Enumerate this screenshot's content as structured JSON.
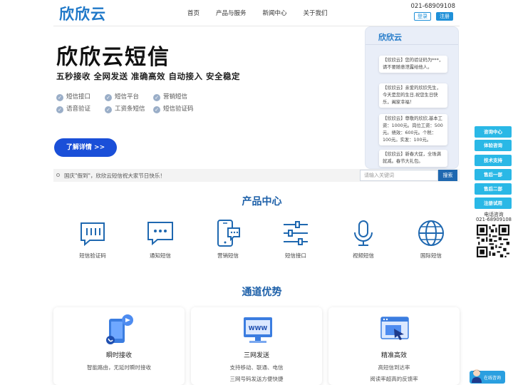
{
  "header": {
    "logo": "欣欣云",
    "nav": [
      "首页",
      "产品与服务",
      "新闻中心",
      "关于我们"
    ],
    "phone": "021-68909108",
    "login": "登录",
    "register": "注册"
  },
  "hero": {
    "title": "欣欣云短信",
    "subtitle": "五秒接收  全网发送  准确高效  自动接入  安全稳定",
    "features": [
      "短信接口",
      "短信平台",
      "营销短信",
      "语音验证",
      "工资条短信",
      "短信验证码"
    ],
    "cta": "了解详情 >>"
  },
  "phone_mockup": {
    "logo": "欣欣云",
    "messages": [
      "【欣欣云】您的验证码为***，请不要随意泄露给他人。",
      "【欣欣云】亲爱的欣欣先生，今天是您的生日,祝您生日快乐，阖家幸福！",
      "【欣欣云】尊敬的欣欣,基本工资：1000元。岗位工资：500元。绩效：600元。个税：100元。实发：100元。",
      "【欣欣云】新春大促，全场满就减。春节大礼包。"
    ]
  },
  "notice": {
    "text": "国庆\"假到\"，欣欣云短信祝大家节日快乐！",
    "search_placeholder": "请输入关键词",
    "search_button": "搜索"
  },
  "products": {
    "title": "产品中心",
    "items": [
      {
        "label": "短信验证码",
        "icon": "sms-code-icon"
      },
      {
        "label": "通知短信",
        "icon": "chat-bubble-icon"
      },
      {
        "label": "营销短信",
        "icon": "mobile-chat-icon"
      },
      {
        "label": "短信接口",
        "icon": "sliders-icon"
      },
      {
        "label": "视频短信",
        "icon": "microphone-icon"
      },
      {
        "label": "国际短信",
        "icon": "globe-icon"
      }
    ]
  },
  "advantages": {
    "title": "通道优势",
    "cards": [
      {
        "title": "瞬时接收",
        "lines": [
          "智能路由，无延时瞬时接收"
        ],
        "icon": "phone-send-icon"
      },
      {
        "title": "三网发送",
        "lines": [
          "支持移动、联通、电信",
          "三网号码发送方便快捷"
        ],
        "icon": "www-monitor-icon"
      },
      {
        "title": "精准高效",
        "lines": [
          "高短信到达率",
          "阅读率超高的反馈率"
        ],
        "icon": "target-screen-icon"
      }
    ]
  },
  "sidebar": {
    "buttons": [
      "咨询中心",
      "体验咨询",
      "技术支持",
      "售后一部",
      "售后二部",
      "注册试用"
    ],
    "phone_label": "电话咨询",
    "phone": "021-68909108",
    "online": "在线咨询"
  },
  "colors": {
    "brand": "#1f78c8",
    "cta": "#1a4fd8",
    "section_title": "#1c5fa8",
    "sidebar": "#2ab8e6",
    "icon": "#1f68b0"
  }
}
